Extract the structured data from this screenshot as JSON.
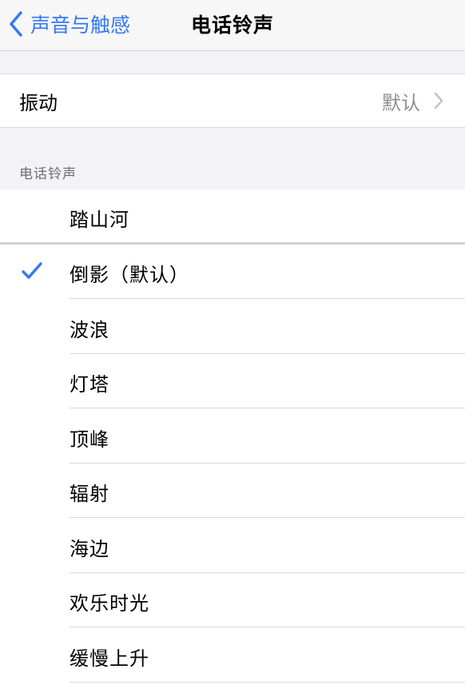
{
  "nav": {
    "back_label": "声音与触感",
    "title": "电话铃声"
  },
  "vibration": {
    "label": "振动",
    "value": "默认"
  },
  "section_header": "电话铃声",
  "ringtones": [
    {
      "name": "踏山河",
      "selected": false
    },
    {
      "name": "倒影（默认）",
      "selected": true
    },
    {
      "name": "波浪",
      "selected": false
    },
    {
      "name": "灯塔",
      "selected": false
    },
    {
      "name": "顶峰",
      "selected": false
    },
    {
      "name": "辐射",
      "selected": false
    },
    {
      "name": "海边",
      "selected": false
    },
    {
      "name": "欢乐时光",
      "selected": false
    },
    {
      "name": "缓慢上升",
      "selected": false
    }
  ],
  "accent_color": "#3478f6"
}
